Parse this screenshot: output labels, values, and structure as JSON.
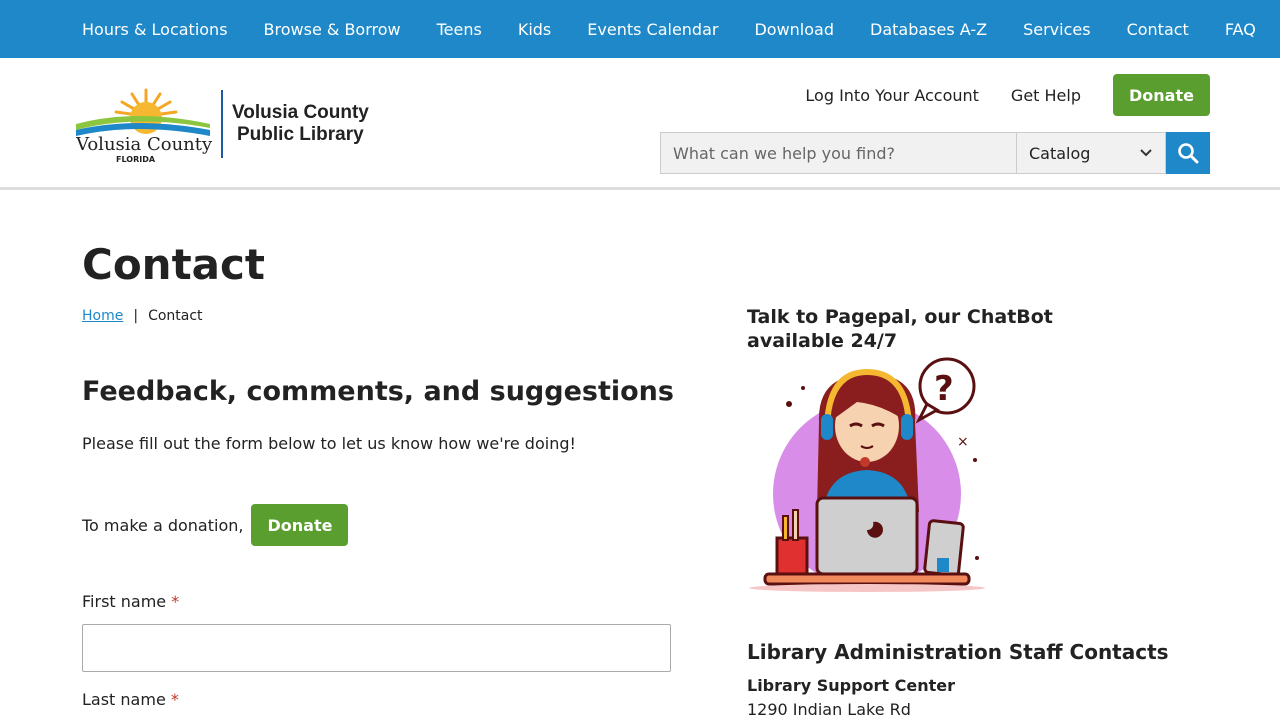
{
  "topnav": {
    "items": [
      "Hours & Locations",
      "Browse & Borrow",
      "Teens",
      "Kids",
      "Events Calendar",
      "Download",
      "Databases A-Z",
      "Services",
      "Contact",
      "FAQ"
    ]
  },
  "header": {
    "logo_county": "Volusia County",
    "logo_state": "FLORIDA",
    "logo_library_line1": "Volusia County",
    "logo_library_line2": "Public Library",
    "login": "Log Into Your Account",
    "help": "Get Help",
    "donate": "Donate"
  },
  "search": {
    "placeholder": "What can we help you find?",
    "scope": "Catalog"
  },
  "page": {
    "title": "Contact",
    "breadcrumb_home": "Home",
    "breadcrumb_sep": "|",
    "breadcrumb_current": "Contact",
    "heading": "Feedback, comments, and suggestions",
    "intro": "Please fill out the form below to let us know how we're doing!",
    "donation_text": "To make a donation,",
    "donation_button": "Donate",
    "first_name_label": "First name",
    "last_name_label": "Last name",
    "required_mark": "*"
  },
  "sidebar": {
    "chat_title": "Talk to Pagepal, our ChatBot available 24/7",
    "staff_heading": "Library Administration Staff Contacts",
    "staff_sub": "Library Support Center",
    "staff_address": "1290 Indian Lake Rd"
  },
  "colors": {
    "nav_blue": "#1e88c8",
    "donate_green": "#5a9e2f"
  }
}
